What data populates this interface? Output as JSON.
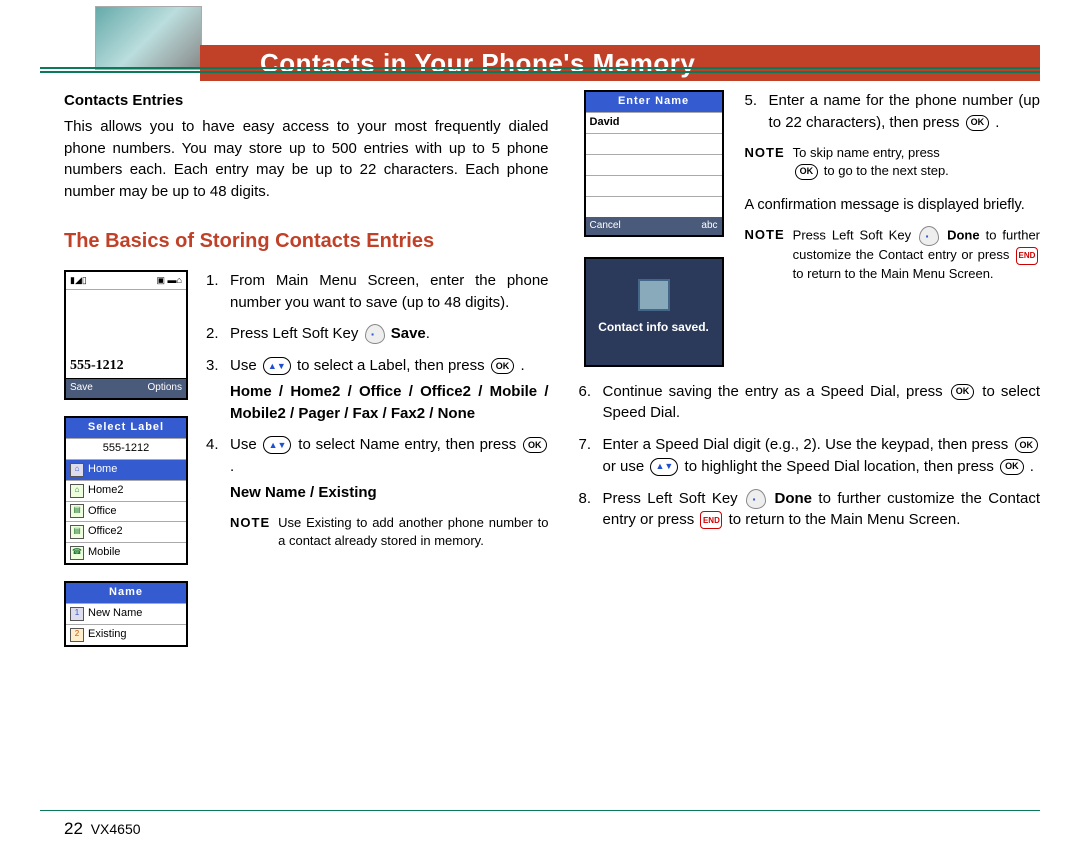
{
  "header": {
    "title": "Contacts in Your Phone's Memory"
  },
  "left": {
    "subhead": "Contacts Entries",
    "intro": "This allows you to have easy access to your most frequently dialed phone numbers. You may store up to 500 entries with up to 5 phone numbers each. Each entry may be up to 22 characters. Each phone number may be up to 48 digits.",
    "section_title": "The Basics of Storing Contacts Entries",
    "screen1": {
      "number": "555-1212",
      "soft_left": "Save",
      "soft_right": "Options"
    },
    "screen2": {
      "title": "Select Label",
      "subtitle": "555-1212",
      "items": [
        "Home",
        "Home2",
        "Office",
        "Office2",
        "Mobile"
      ]
    },
    "screen3": {
      "title": "Name",
      "items": [
        "New Name",
        "Existing"
      ]
    },
    "steps": {
      "s1": "From Main Menu Screen, enter the phone number you want to save (up to 48 digits).",
      "s2_a": "Press Left Soft Key ",
      "s2_b": " Save",
      "s2_c": ".",
      "s3_a": "Use ",
      "s3_b": " to select a Label, then press ",
      "s3_c": " .",
      "s3_labels": "Home / Home2 / Office / Office2 / Mobile / Mobile2 / Pager / Fax / Fax2 / None",
      "s4_a": "Use ",
      "s4_b": " to select Name entry, then press ",
      "s4_c": " .",
      "s4_labels": "New Name / Existing"
    },
    "note1": "Use Existing to add another phone number to a contact already stored in memory."
  },
  "right": {
    "screen4": {
      "title": "Enter Name",
      "value": "David",
      "soft_left": "Cancel",
      "soft_right": "abc"
    },
    "screen5": {
      "msg": "Contact info saved."
    },
    "s5_a": "Enter a name for the phone number (up to 22 characters), then press ",
    "s5_b": " .",
    "note2_a": "To skip name entry, press",
    "note2_b": " to go to the next step.",
    "confirm": "A confirmation message is displayed briefly.",
    "note3_a": "Press Left Soft Key ",
    "note3_b": " Done",
    "note3_c": " to further customize the Contact entry or press ",
    "note3_d": " to return to the Main Menu Screen.",
    "s6_a": "Continue saving the entry as a Speed Dial, press ",
    "s6_b": " to select Speed Dial.",
    "s7_a": "Enter a Speed Dial digit (e.g., 2). Use the keypad, then press ",
    "s7_b": " or use ",
    "s7_c": " to highlight the Speed Dial location, then press ",
    "s7_d": " .",
    "s8_a": "Press Left Soft Key ",
    "s8_b": " Done",
    "s8_c": " to further customize the Contact entry or press ",
    "s8_d": " to return to the Main Menu Screen."
  },
  "footer": {
    "page": "22",
    "model": "VX4650"
  },
  "labels": {
    "note": "NOTE",
    "ok": "OK",
    "nav": "▲▼",
    "end": "END"
  }
}
